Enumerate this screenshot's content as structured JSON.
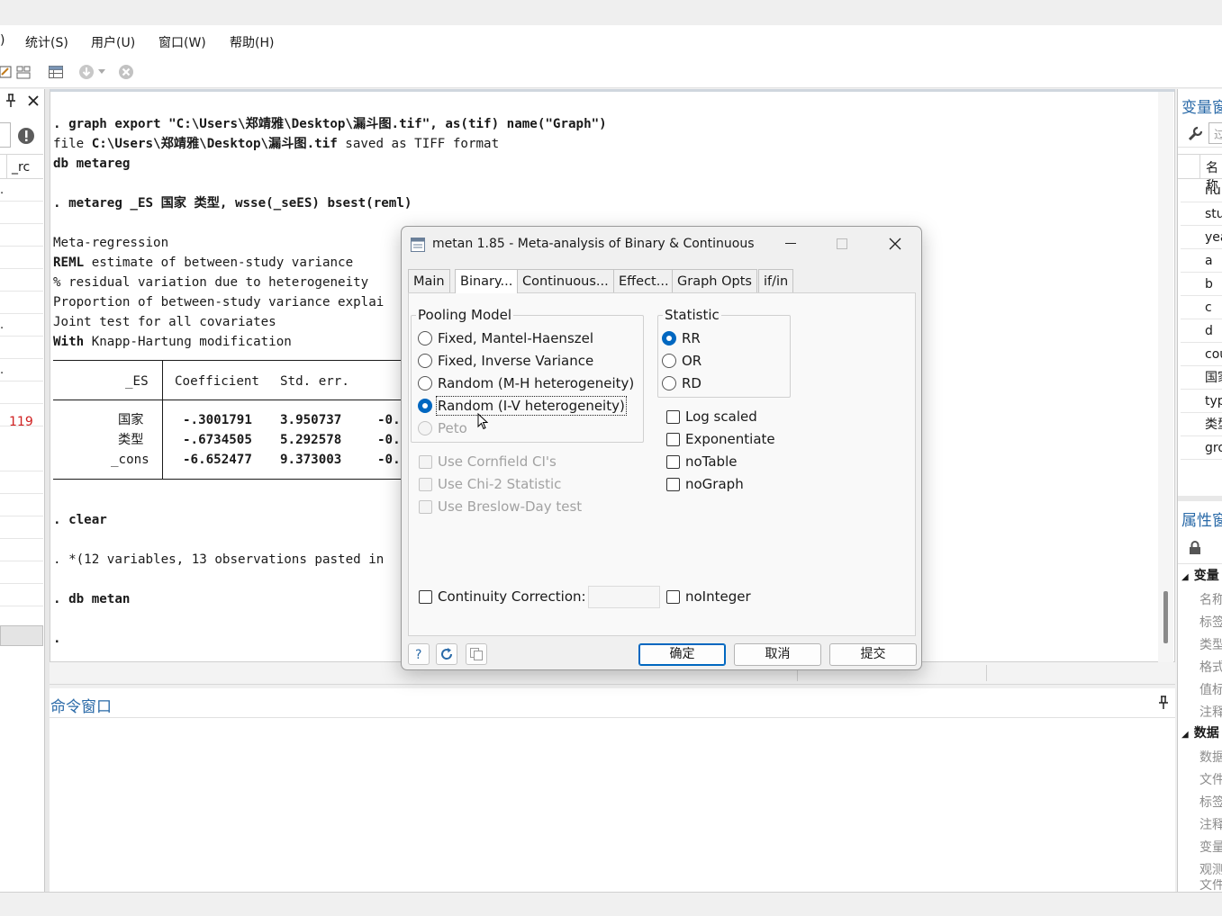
{
  "menubar": {
    "items": [
      ")",
      "统计(S)",
      "用户(U)",
      "窗口(W)",
      "帮助(H)"
    ]
  },
  "left_pane": {
    "col_header": "_rc",
    "marker": "119"
  },
  "results": {
    "lines": [
      {
        "prefix": ". ",
        "text": "graph export \"C:\\Users\\郑靖雅\\Desktop\\漏斗图.tif\", as(tif) name(\"Graph\")"
      },
      {
        "prefix": "file ",
        "text": "C:\\Users\\郑靖雅\\Desktop\\漏斗图.tif",
        "suffix": " saved as TIFF format"
      },
      {
        "text": "db metareg"
      },
      {
        "prefix": ". ",
        "text": "metareg _ES 国家 类型, wsse(_seES) bsest(reml)"
      },
      {
        "text": "Meta-regression"
      },
      {
        "prefix": "REML",
        "text": " estimate of between-study variance"
      },
      {
        "text": "% residual variation due to heterogeneity"
      },
      {
        "text": "Proportion of between-study variance explai"
      },
      {
        "text": "Joint test for all covariates"
      },
      {
        "prefix": "With",
        "text": " Knapp-Hartung modification"
      }
    ],
    "table": {
      "header_var": "_ES",
      "header_cols": [
        "Coefficient",
        "Std. err."
      ],
      "rows": [
        {
          "label": "国家",
          "coef": "-.3001791",
          "se": "3.950737",
          "t": "-0."
        },
        {
          "label": "类型",
          "coef": "-.6734505",
          "se": "5.292578",
          "t": "-0."
        },
        {
          "label": "_cons",
          "coef": "-6.652477",
          "se": "9.373003",
          "t": "-0."
        }
      ]
    },
    "after": [
      {
        "prefix": ". ",
        "text": "clear"
      },
      {
        "prefix": ". ",
        "text": "*(12 variables, 13 observations pasted in"
      },
      {
        "prefix": ". ",
        "text": "db metan"
      },
      {
        "text": "."
      }
    ]
  },
  "command_window": {
    "title": "命令窗口"
  },
  "variables_panel": {
    "title": "变量窗",
    "search_placeholder": "过",
    "col_header": "名称",
    "items": [
      "nur",
      "stu",
      "yea",
      "a",
      "b",
      "c",
      "d",
      "cou",
      "国家",
      "typ",
      "类型",
      "gro"
    ]
  },
  "properties_panel": {
    "title": "属性窗",
    "sections": [
      {
        "label": "变量",
        "items": [
          "名称",
          "标签",
          "类型",
          "格式",
          "值标",
          "注释"
        ]
      },
      {
        "label": "数据",
        "items": [
          "数据",
          "文件",
          "标签",
          "注释",
          "变量",
          "观测",
          "文件"
        ]
      }
    ]
  },
  "dialog": {
    "title": "metan 1.85 - Meta-analysis of Binary & Continuous",
    "tabs": [
      "Main",
      "Binary...",
      "Continuous...",
      "Effect...",
      "Graph Opts",
      "if/in"
    ],
    "active_tab": "Binary...",
    "pooling_model": {
      "label": "Pooling Model",
      "options": [
        "Fixed, Mantel-Haenszel",
        "Fixed, Inverse Variance",
        "Random (M-H heterogeneity)",
        "Random (I-V heterogeneity)",
        "Peto"
      ],
      "selected": "Random (I-V heterogeneity)"
    },
    "statistic": {
      "label": "Statistic",
      "options": [
        "RR",
        "OR",
        "RD"
      ],
      "selected": "RR"
    },
    "checkboxes_right": [
      "Log scaled",
      "Exponentiate",
      "noTable",
      "noGraph"
    ],
    "checkboxes_disabled": [
      "Use Cornfield CI's",
      "Use Chi-2 Statistic",
      "Use Breslow-Day test"
    ],
    "continuity_correction": "Continuity Correction:",
    "continuity_value": "",
    "nointeger": "noInteger",
    "buttons": {
      "ok": "确定",
      "cancel": "取消",
      "submit": "提交"
    }
  }
}
